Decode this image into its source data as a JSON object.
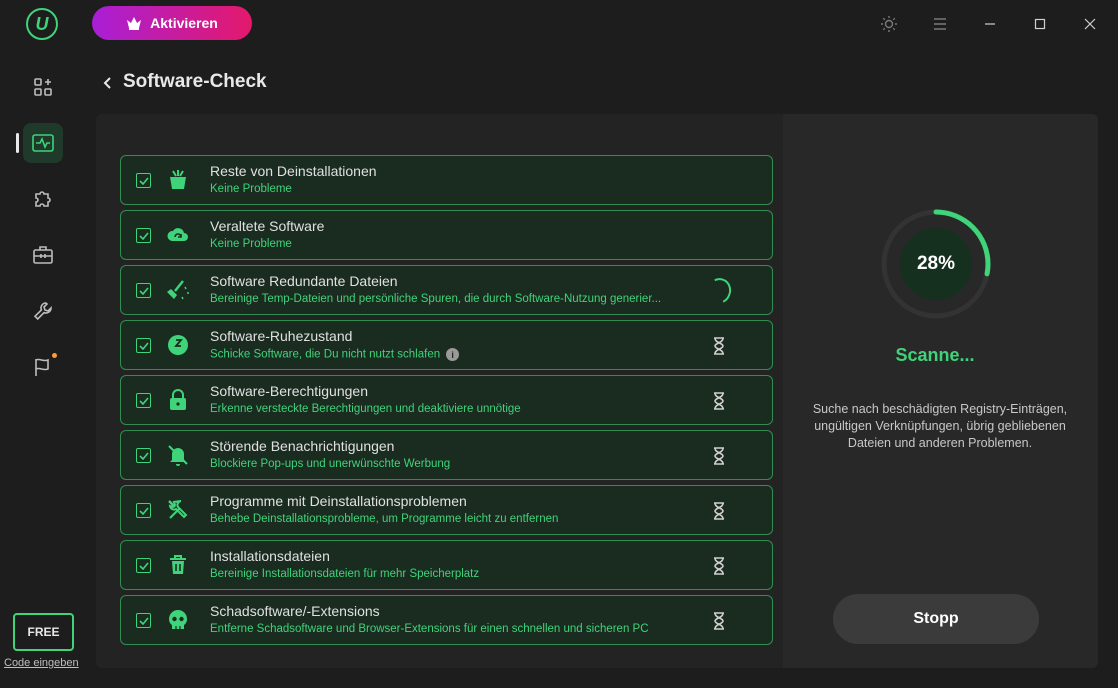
{
  "app": {
    "logo_letter": "U",
    "activate_label": "Aktivieren"
  },
  "sidebar": {
    "items": [
      {
        "name": "dashboard-icon",
        "active": false
      },
      {
        "name": "health-monitor-icon",
        "active": true
      },
      {
        "name": "puzzle-icon",
        "active": false
      },
      {
        "name": "toolbox-icon",
        "active": false
      },
      {
        "name": "wrench-icon",
        "active": false
      },
      {
        "name": "flag-icon",
        "active": false,
        "notification": true
      }
    ],
    "free_label": "FREE",
    "code_link": "Code eingeben"
  },
  "header": {
    "title": "Software-Check"
  },
  "checks": [
    {
      "title": "Reste von Deinstallationen",
      "desc": "Keine Probleme",
      "icon": "cleanup-bin-icon",
      "status": "done",
      "checked": true
    },
    {
      "title": "Veraltete Software",
      "desc": "Keine Probleme",
      "icon": "cloud-update-icon",
      "status": "done",
      "checked": true
    },
    {
      "title": "Software Redundante Dateien",
      "desc": "Bereinige Temp-Dateien und persönliche Spuren, die durch Software-Nutzung generier...",
      "icon": "broom-icon",
      "status": "scanning",
      "checked": true
    },
    {
      "title": "Software-Ruhezustand",
      "desc": "Schicke Software, die Du nicht nutzt schlafen",
      "icon": "sleep-icon",
      "status": "pending",
      "checked": true,
      "info": true
    },
    {
      "title": "Software-Berechtigungen",
      "desc": "Erkenne versteckte Berechtigungen und deaktiviere unnötige",
      "icon": "lock-icon",
      "status": "pending",
      "checked": true
    },
    {
      "title": "Störende Benachrichtigungen",
      "desc": "Blockiere Pop-ups und unerwünschte Werbung",
      "icon": "bell-off-icon",
      "status": "pending",
      "checked": true
    },
    {
      "title": "Programme mit Deinstallationsproblemen",
      "desc": "Behebe Deinstallationsprobleme, um Programme leicht zu entfernen",
      "icon": "tools-icon",
      "status": "pending",
      "checked": true
    },
    {
      "title": "Installationsdateien",
      "desc": "Bereinige Installationsdateien für mehr Speicherplatz",
      "icon": "trash-icon",
      "status": "pending",
      "checked": true
    },
    {
      "title": "Schadsoftware/-Extensions",
      "desc": "Entferne Schadsoftware und Browser-Extensions für einen schnellen und sicheren PC",
      "icon": "skull-icon",
      "status": "pending",
      "checked": true
    }
  ],
  "progress": {
    "percent": 0.28,
    "label": "28%",
    "status_label": "Scanne...",
    "description": "Suche nach beschädigten Registry-Einträgen, ungültigen Verknüpfungen, übrig gebliebenen Dateien und anderen Problemen.",
    "stop_label": "Stopp"
  },
  "colors": {
    "accent": "#3fd37a",
    "background": "#1d1d1d",
    "panel": "#232323",
    "item_bg": "#1a2c20",
    "activate_start": "#a81fd6",
    "activate_end": "#e4196b"
  }
}
